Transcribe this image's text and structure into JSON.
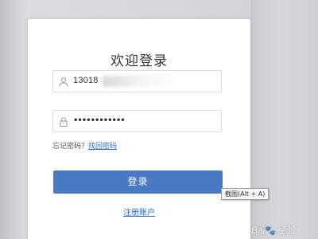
{
  "login": {
    "title": "欢迎登录",
    "phone_value": "13018",
    "password_value": "••••••••••••",
    "forgot_prefix": "忘记密码？",
    "forgot_link": "找回密码",
    "login_button": "登录",
    "register_link": "注册账户"
  },
  "tooltip": {
    "text": "截图(Alt + A)"
  },
  "watermark": {
    "text_left": "Bai",
    "paw": "🐾",
    "text_right": "经验"
  },
  "icons": {
    "phone_field_icon": "user-icon",
    "password_field_icon": "lock-icon"
  },
  "colors": {
    "primary_button": "#4a79c3",
    "link": "#2a6ac0"
  }
}
